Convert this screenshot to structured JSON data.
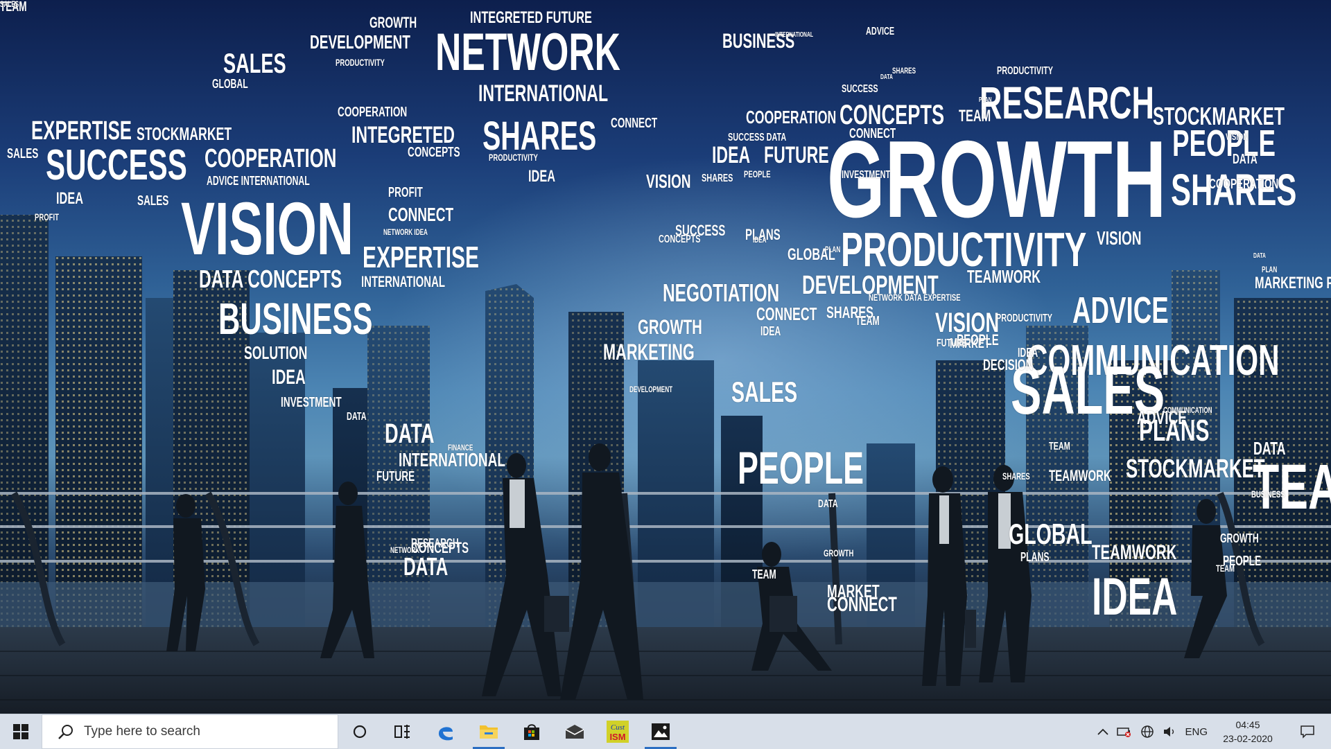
{
  "wallpaper": {
    "words": [
      {
        "text": "GROWTH",
        "size": 22
      },
      {
        "text": "INTEGRETED FUTURE",
        "size": 24
      },
      {
        "text": "DEVELOPMENT",
        "size": 28
      },
      {
        "text": "NETWORK",
        "size": 76
      },
      {
        "text": "SALES",
        "size": 40
      },
      {
        "text": "PRODUCTIVITY",
        "size": 14
      },
      {
        "text": "GLOBAL",
        "size": 18
      },
      {
        "text": "BUSINESS",
        "size": 30
      },
      {
        "text": "INTERNATIONAL",
        "size": 10
      },
      {
        "text": "ADVICE",
        "size": 16
      },
      {
        "text": "INTERNATIONAL",
        "size": 34
      },
      {
        "text": "COOPERATION",
        "size": 20
      },
      {
        "text": "SHARES",
        "size": 58
      },
      {
        "text": "CONNECT",
        "size": 20
      },
      {
        "text": "EXPERTISE",
        "size": 38
      },
      {
        "text": "STOCKMARKET",
        "size": 26
      },
      {
        "text": "INTEGRETED",
        "size": 34
      },
      {
        "text": "CONCEPTS",
        "size": 20
      },
      {
        "text": "SALES",
        "size": 20
      },
      {
        "text": "SUCCESS",
        "size": 62
      },
      {
        "text": "COOPERATION",
        "size": 38
      },
      {
        "text": "PRODUCTIVITY",
        "size": 14
      },
      {
        "text": "IDEA",
        "size": 24
      },
      {
        "text": "ADVICE INTERNATIONAL",
        "size": 18
      },
      {
        "text": "IDEA",
        "size": 24
      },
      {
        "text": "SALES",
        "size": 20
      },
      {
        "text": "PROFIT",
        "size": 14
      },
      {
        "text": "VISION",
        "size": 108
      },
      {
        "text": "PROFIT",
        "size": 20
      },
      {
        "text": "CONNECT",
        "size": 28
      },
      {
        "text": "NETWORK IDEA",
        "size": 12
      },
      {
        "text": "EXPERTISE",
        "size": 44
      },
      {
        "text": "DATA CONCEPTS",
        "size": 36
      },
      {
        "text": "INTERNATIONAL",
        "size": 22
      },
      {
        "text": "BUSINESS",
        "size": 64
      },
      {
        "text": "SOLUTION",
        "size": 26
      },
      {
        "text": "IDEA",
        "size": 30
      },
      {
        "text": "INVESTMENT",
        "size": 20
      },
      {
        "text": "DATA",
        "size": 16
      },
      {
        "text": "PRODUCTIVITY",
        "size": 16
      },
      {
        "text": "SHARES",
        "size": 12
      },
      {
        "text": "SUCCESS",
        "size": 16
      },
      {
        "text": "DATA",
        "size": 10
      },
      {
        "text": "RESEARCH",
        "size": 66
      },
      {
        "text": "PLAN",
        "size": 10
      },
      {
        "text": "COOPERATION",
        "size": 26
      },
      {
        "text": "CONCEPTS",
        "size": 40
      },
      {
        "text": "TEAM",
        "size": 24
      },
      {
        "text": "STOCKMARKET",
        "size": 36
      },
      {
        "text": "CONNECT",
        "size": 20
      },
      {
        "text": "SUCCESS DATA",
        "size": 16
      },
      {
        "text": "IDEA",
        "size": 34
      },
      {
        "text": "FUTURE",
        "size": 34
      },
      {
        "text": "GROWTH",
        "size": 158
      },
      {
        "text": "PEOPLE",
        "size": 54
      },
      {
        "text": "VISION",
        "size": 14
      },
      {
        "text": "DATA",
        "size": 20
      },
      {
        "text": "INVESTMENT",
        "size": 16
      },
      {
        "text": "PEOPLE",
        "size": 14
      },
      {
        "text": "VISION",
        "size": 28
      },
      {
        "text": "SHARES",
        "size": 64
      },
      {
        "text": "COOPERATION",
        "size": 20
      },
      {
        "text": "SHARES",
        "size": 16
      },
      {
        "text": "SUCCESS",
        "size": 22
      },
      {
        "text": "CONCEPTS",
        "size": 16
      },
      {
        "text": "PLANS",
        "size": 22
      },
      {
        "text": "IDEA",
        "size": 12
      },
      {
        "text": "PLAN",
        "size": 12
      },
      {
        "text": "GLOBAL",
        "size": 24
      },
      {
        "text": "PRODUCTIVITY",
        "size": 70
      },
      {
        "text": "VISION",
        "size": 28
      },
      {
        "text": "DATA",
        "size": 10
      },
      {
        "text": "PLAN",
        "size": 12
      },
      {
        "text": "MARKETING PARTNERSHIP",
        "size": 24
      },
      {
        "text": "DEVELOPMENT",
        "size": 38
      },
      {
        "text": "TEAMWORK",
        "size": 26
      },
      {
        "text": "NETWORK DATA EXPERTISE",
        "size": 14
      },
      {
        "text": "ADVICE",
        "size": 54
      },
      {
        "text": "NEGOTIATION",
        "size": 36
      },
      {
        "text": "GROWTH",
        "size": 30
      },
      {
        "text": "CONNECT",
        "size": 26
      },
      {
        "text": "SHARES",
        "size": 24
      },
      {
        "text": "VISION",
        "size": 40
      },
      {
        "text": "PRODUCTIVITY",
        "size": 16
      },
      {
        "text": "IDEA",
        "size": 18
      },
      {
        "text": "TEAM",
        "size": 18
      },
      {
        "text": "MARKET",
        "size": 20
      },
      {
        "text": "COMMUNICATION",
        "size": 62
      },
      {
        "text": "IDEA",
        "size": 18
      },
      {
        "text": "PEOPLE",
        "size": 22
      },
      {
        "text": "MARKETING",
        "size": 32
      },
      {
        "text": "SALES",
        "size": 98
      },
      {
        "text": "DECISION",
        "size": 22
      },
      {
        "text": "FUTURE",
        "size": 16
      },
      {
        "text": "DEVELOPMENT",
        "size": 12
      },
      {
        "text": "SALES",
        "size": 42
      },
      {
        "text": "ADVICE",
        "size": 28
      },
      {
        "text": "COMMUNICATION",
        "size": 12
      },
      {
        "text": "PLANS",
        "size": 44
      },
      {
        "text": "DATA",
        "size": 40
      },
      {
        "text": "FINANCE",
        "size": 12
      },
      {
        "text": "INTERNATIONAL",
        "size": 28
      },
      {
        "text": "TEAM",
        "size": 16
      },
      {
        "text": "STOCKMARKET",
        "size": 38
      },
      {
        "text": "PEOPLE",
        "size": 66
      },
      {
        "text": "SHARES",
        "size": 14
      },
      {
        "text": "DATA",
        "size": 26
      },
      {
        "text": "TEAM",
        "size": 92
      },
      {
        "text": "TEAMWORK",
        "size": 22
      },
      {
        "text": "BUSINESS",
        "size": 14
      },
      {
        "text": "FUTURE",
        "size": 20
      },
      {
        "text": "GLOBAL",
        "size": 42
      },
      {
        "text": "DATA",
        "size": 16
      },
      {
        "text": "GROWTH",
        "size": 14
      },
      {
        "text": "CONNECT",
        "size": 30
      },
      {
        "text": "RESEARCH",
        "size": 18
      },
      {
        "text": "TEAMWORK",
        "size": 30
      },
      {
        "text": "NETWORK",
        "size": 12
      },
      {
        "text": "PLANS",
        "size": 18
      },
      {
        "text": "IDEA",
        "size": 76
      },
      {
        "text": "TEAM",
        "size": 18
      },
      {
        "text": "CONCEPTS",
        "size": 22
      },
      {
        "text": "PEOPLE",
        "size": 20
      },
      {
        "text": "TEAM",
        "size": 14
      },
      {
        "text": "MARKET",
        "size": 26
      },
      {
        "text": "DATA",
        "size": 36
      },
      {
        "text": "GROWTH",
        "size": 18
      },
      {
        "text": "TEAM",
        "size": 20
      },
      {
        "text": "SALES",
        "size": 12
      }
    ]
  },
  "taskbar": {
    "search_placeholder": "Type here to search",
    "pinned": [
      {
        "name": "cortana-button",
        "icon": "cortana-circle-icon"
      },
      {
        "name": "task-view-button",
        "icon": "task-view-icon"
      },
      {
        "name": "edge-button",
        "icon": "edge-icon"
      },
      {
        "name": "file-explorer-button",
        "icon": "folder-icon"
      },
      {
        "name": "store-button",
        "icon": "store-bag-icon"
      },
      {
        "name": "mail-button",
        "icon": "mail-icon"
      },
      {
        "name": "cust-ism-app-button",
        "icon": "cust-ism-icon",
        "label_top": "Cust",
        "label_bottom": "ISM"
      },
      {
        "name": "photos-button",
        "icon": "photos-icon"
      }
    ],
    "tray": {
      "language": "ENG",
      "time": "04:45",
      "date": "23-02-2020"
    }
  },
  "colors": {
    "taskbar_bg": "#d8dfe9",
    "accent": "#2b6ec2",
    "edge_blue": "#1f72d2",
    "folder_yellow": "#f2c12e",
    "cust_ism_bg": "#d1d128",
    "cust_ism_text": "#d0152b"
  }
}
